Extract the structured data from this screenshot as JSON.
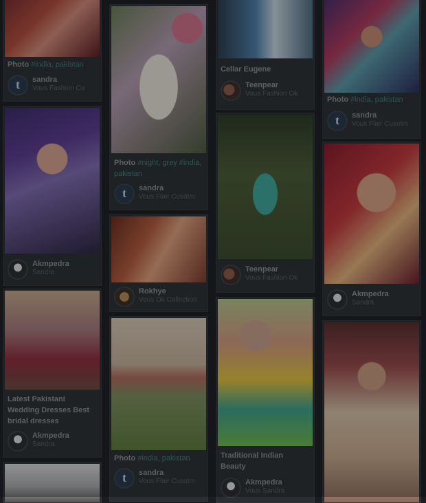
{
  "colors": {
    "background": "#1b1d20",
    "card": "#2b2e32",
    "tag": "#3e7f7b"
  },
  "pins": {
    "c1p1": {
      "caption_prefix": "Photo",
      "tags": "#india, pakistan",
      "user": "sandra",
      "via": "Vous Fashion Cu"
    },
    "c1p2": {
      "user": "Akmpedra",
      "via": "Sandra"
    },
    "c1p3": {
      "caption": "Latest Pakistani Wedding Dresses Best bridal dresses",
      "user": "Akmpedra",
      "via": "Sandra"
    },
    "c2p1": {
      "caption_prefix": "Photo",
      "tags": "#night, grey #india, pakistan",
      "user": "sandra",
      "via": "Vous Flair Cusotm"
    },
    "c2p2": {
      "user": "Rokhye",
      "via": "Vous Ok Collection"
    },
    "c2p3": {
      "caption_prefix": "Photo",
      "tags": "#india, pakistan",
      "user": "sandra",
      "via": "Vous Flair Cusotm"
    },
    "c3p1": {
      "caption": "Cellar Eugene",
      "user": "Teenpear",
      "via": "Vous Fashion Ok"
    },
    "c3p2": {
      "user": "Teenpear",
      "via": "Vous Fashion Ok"
    },
    "c3p3": {
      "caption": "Traditional Indian Beauty",
      "user": "Akmpedra",
      "via": "Vous Sandra"
    },
    "c4p1": {
      "caption_prefix": "Photo",
      "tags": "#india, pakistan",
      "user": "sandra",
      "via": "Vous Flair Cusotm"
    },
    "c4p2": {
      "user": "Akmpedra",
      "via": "Sandra"
    }
  },
  "icons": {
    "tumblr_avatar": "tumblr-avatar-icon"
  }
}
